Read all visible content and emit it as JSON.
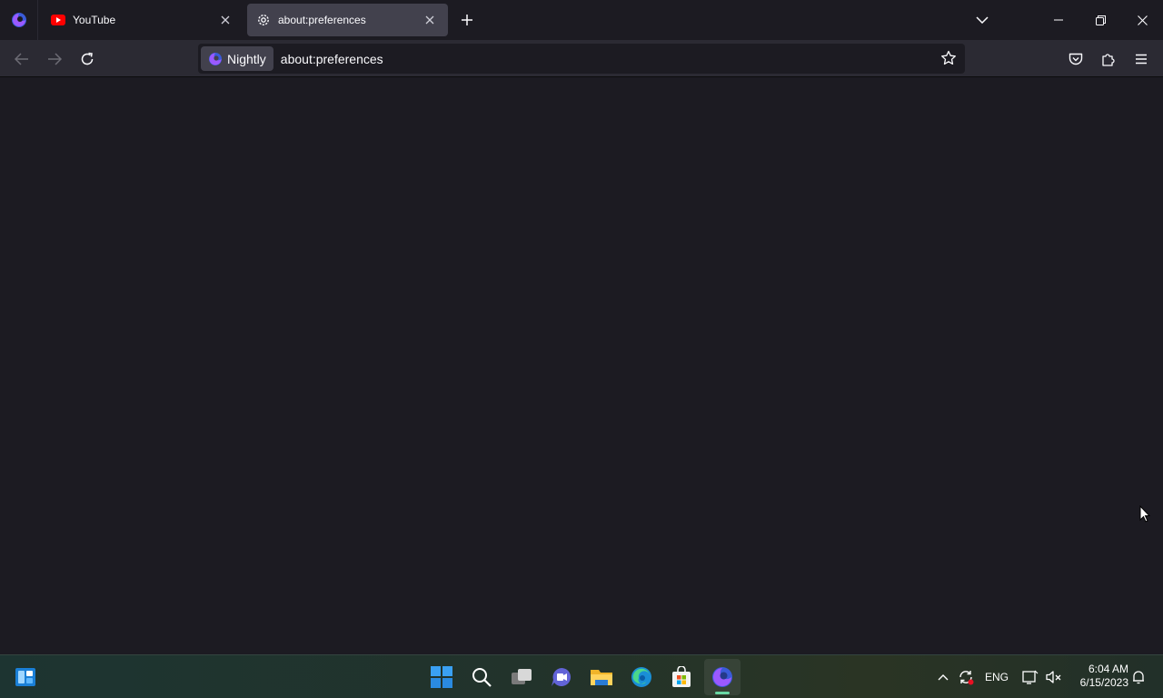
{
  "tabs": [
    {
      "title": "YouTube",
      "icon": "youtube-icon",
      "active": false
    },
    {
      "title": "about:preferences",
      "icon": "gear-icon",
      "active": true
    }
  ],
  "urlbar": {
    "identity_label": "Nightly",
    "url": "about:preferences"
  },
  "taskbar": {
    "language": "ENG",
    "time": "6:04 AM",
    "date": "6/15/2023"
  },
  "colors": {
    "tab_background": "#1c1b22",
    "toolbar": "#2b2a33",
    "active_tab": "#42414d",
    "content": "#1c1b22"
  }
}
